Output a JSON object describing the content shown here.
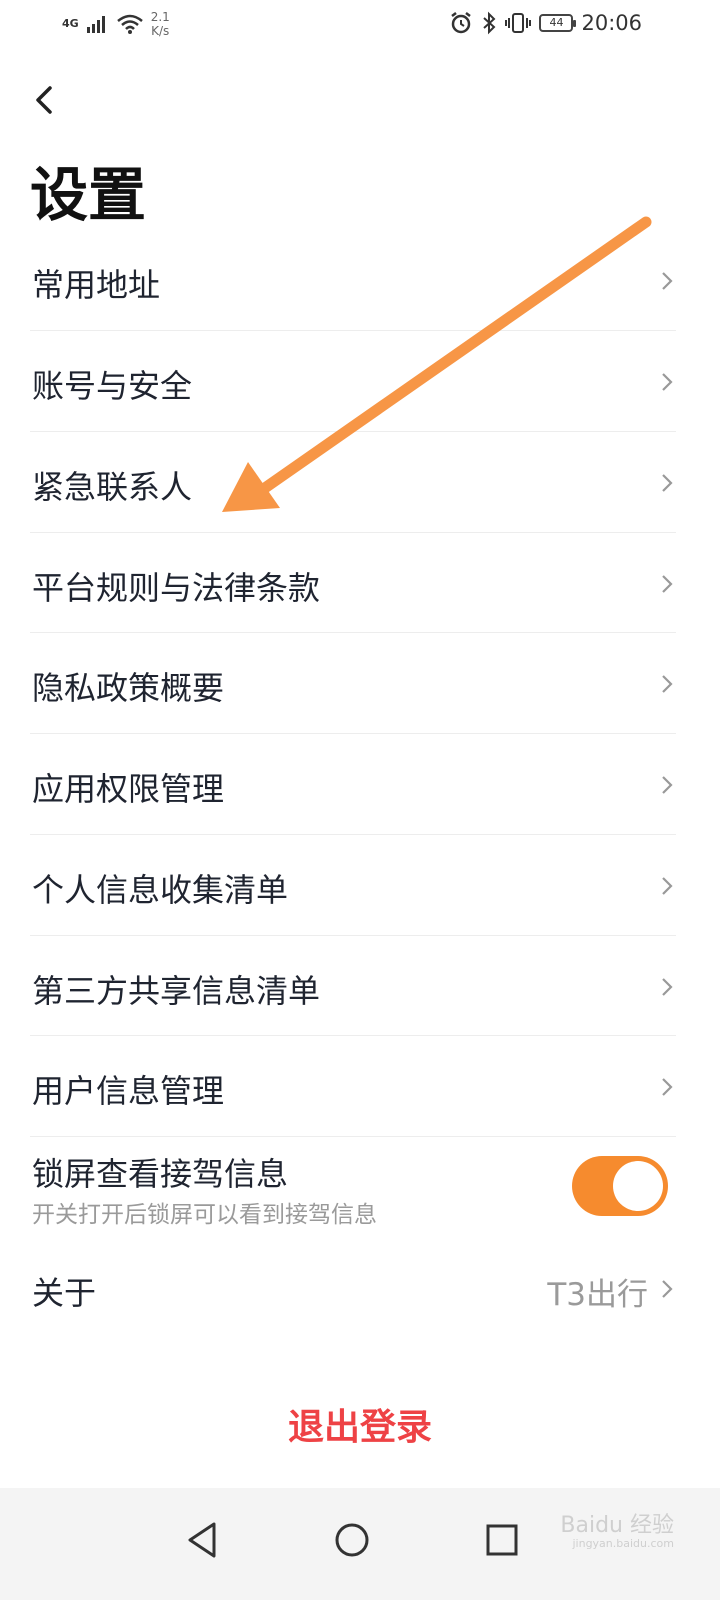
{
  "status_bar": {
    "network": "4G",
    "speed_value": "2.1",
    "speed_unit": "K/s",
    "battery": "44",
    "time": "20:06"
  },
  "header": {
    "title": "设置"
  },
  "menu": {
    "items": [
      {
        "label": "常用地址"
      },
      {
        "label": "账号与安全"
      },
      {
        "label": "紧急联系人"
      },
      {
        "label": "平台规则与法律条款"
      },
      {
        "label": "隐私政策概要"
      },
      {
        "label": "应用权限管理"
      },
      {
        "label": "个人信息收集清单"
      },
      {
        "label": "第三方共享信息清单"
      },
      {
        "label": "用户信息管理"
      }
    ],
    "lock_screen": {
      "label": "锁屏查看接驾信息",
      "description": "开关打开后锁屏可以看到接驾信息",
      "enabled": true
    },
    "about": {
      "label": "关于",
      "value": "T3出行"
    }
  },
  "logout": {
    "label": "退出登录"
  },
  "watermark": {
    "text": "Baidu 经验",
    "url": "jingyan.baidu.com"
  },
  "colors": {
    "accent": "#f68b2e",
    "logout": "#ee4245",
    "annotation_arrow": "#f79646"
  }
}
